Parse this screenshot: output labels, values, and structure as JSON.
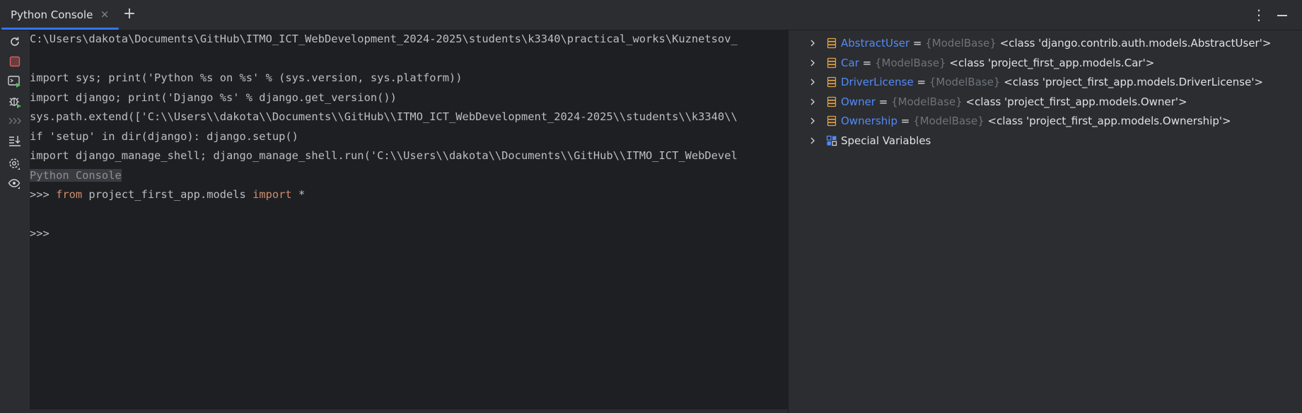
{
  "tab": {
    "label": "Python Console",
    "close": "×",
    "new": "+",
    "more": "⋮"
  },
  "console": {
    "lines": [
      "C:\\Users\\dakota\\Documents\\GitHub\\ITMO_ICT_WebDevelopment_2024-2025\\students\\k3340\\practical_works\\Kuznetsov_",
      "",
      "import sys; print('Python %s on %s' % (sys.version, sys.platform))",
      "import django; print('Django %s' % django.get_version())",
      "sys.path.extend(['C:\\\\Users\\\\dakota\\\\Documents\\\\GitHub\\\\ITMO_ICT_WebDevelopment_2024-2025\\\\students\\\\k3340\\\\",
      "if 'setup' in dir(django): django.setup()",
      "import django_manage_shell; django_manage_shell.run('C:\\\\Users\\\\dakota\\\\Documents\\\\GitHub\\\\ITMO_ICT_WebDevel"
    ],
    "banner": "Python Console",
    "prompt": ">>> ",
    "cmd_from": "from",
    "cmd_module": " project_first_app.models ",
    "cmd_import": "import",
    "cmd_star": " *",
    "prompt2": ">>>"
  },
  "variables": [
    {
      "name": "AbstractUser",
      "eq": " = ",
      "type": "{ModelBase}",
      "value": " <class 'django.contrib.auth.models.AbstractUser'>"
    },
    {
      "name": "Car",
      "eq": " = ",
      "type": "{ModelBase}",
      "value": " <class 'project_first_app.models.Car'>"
    },
    {
      "name": "DriverLicense",
      "eq": " = ",
      "type": "{ModelBase}",
      "value": " <class 'project_first_app.models.DriverLicense'>"
    },
    {
      "name": "Owner",
      "eq": " = ",
      "type": "{ModelBase}",
      "value": " <class 'project_first_app.models.Owner'>"
    },
    {
      "name": "Ownership",
      "eq": " = ",
      "type": "{ModelBase}",
      "value": " <class 'project_first_app.models.Ownership'>"
    }
  ],
  "special": {
    "label": "Special Variables"
  },
  "icons": {
    "rerun": "rerun-icon",
    "stop": "stop-icon",
    "new_console": "new-console-icon",
    "debug": "debug-icon",
    "history": "history-icon",
    "scroll_end": "scroll-to-end-icon",
    "settings": "settings-icon",
    "show_vars": "show-variables-icon",
    "var_item": "model-class-icon",
    "special_vars": "special-variables-icon"
  },
  "colors": {
    "accent": "#3574f0",
    "keyword": "#cf8e6d",
    "var_name": "#548af7",
    "stop": "#db5c5c"
  }
}
